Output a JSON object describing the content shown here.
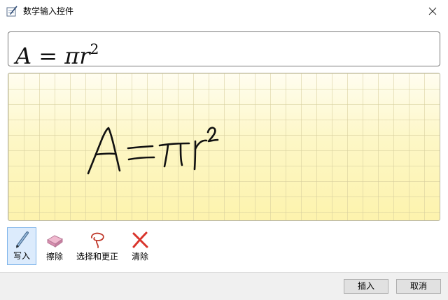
{
  "window": {
    "title": "数学输入控件",
    "app_icon": "math-input-icon",
    "close_icon": "close-icon"
  },
  "preview": {
    "equation_lhs": "A",
    "equation_eq": " = ",
    "equation_pi": "π",
    "equation_r": "r",
    "equation_exp": "2"
  },
  "ink": {
    "handwriting": "A=πr²",
    "background": "yellow-grid-paper",
    "ink_color": "#111111"
  },
  "toolbar": {
    "tools": [
      {
        "label": "写入",
        "icon": "pen-icon",
        "active": true
      },
      {
        "label": "擦除",
        "icon": "eraser-icon",
        "active": false
      },
      {
        "label": "选择和更正",
        "icon": "lasso-select-icon",
        "active": false
      },
      {
        "label": "清除",
        "icon": "clear-x-icon",
        "active": false
      }
    ]
  },
  "footer": {
    "insert_label": "插入",
    "cancel_label": "取消"
  },
  "colors": {
    "accent_selected": "#dcebfc",
    "grid_paper": "#fdf7c5",
    "clear_red": "#d9342b"
  }
}
